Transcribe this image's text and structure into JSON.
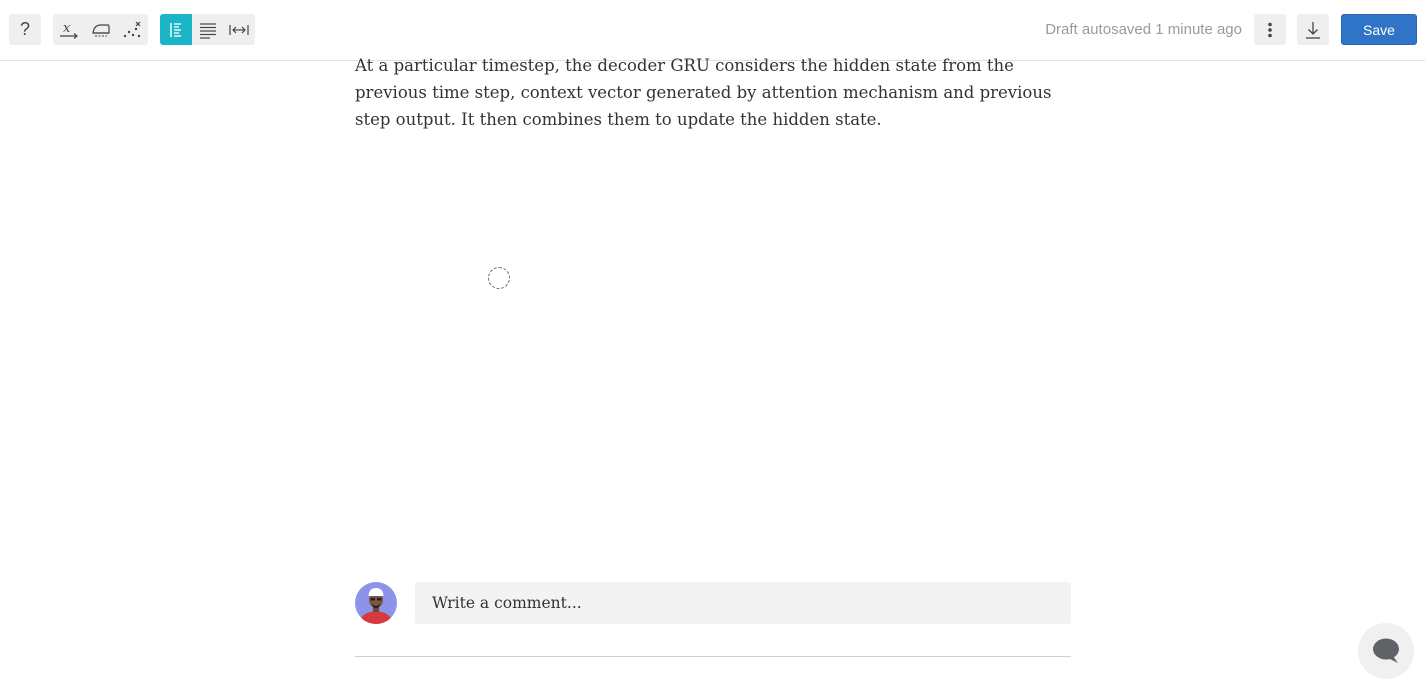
{
  "toolbar": {
    "help_label": "?",
    "status_text": "Draft autosaved 1 minute ago",
    "save_label": "Save",
    "active_color": "#1ab5c7",
    "save_color": "#2f74c7",
    "icons": [
      "question-icon",
      "math-formula-icon",
      "clean-format-icon",
      "scatter-icon",
      "align-left-icon",
      "justify-icon",
      "width-toggle-icon",
      "more-vertical-icon",
      "download-icon"
    ]
  },
  "article": {
    "paragraph": "At a particular timestep, the decoder GRU considers the hidden state from the previous time step, context vector generated by attention mechanism and previous step output. It then combines them to update the hidden state."
  },
  "comments": {
    "placeholder": "Write a comment..."
  }
}
